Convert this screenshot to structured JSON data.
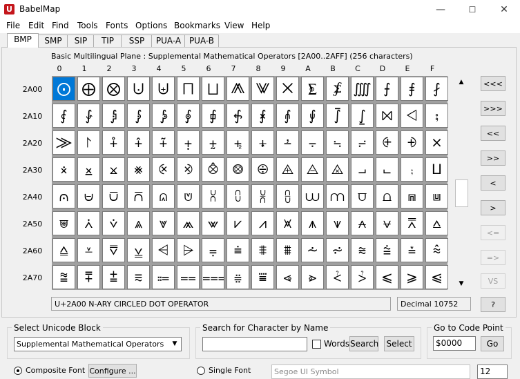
{
  "window": {
    "title": "BabelMap",
    "app_icon": "U",
    "minimize": "—",
    "maximize": "☐",
    "close": "✕"
  },
  "menu": [
    "File",
    "Edit",
    "Find",
    "Tools",
    "Fonts",
    "Options",
    "Bookmarks",
    "View",
    "Help"
  ],
  "tabs": [
    "BMP",
    "SMP",
    "SIP",
    "TIP",
    "SSP",
    "PUA-A",
    "PUA-B"
  ],
  "active_tab": "BMP",
  "block_title": "Basic Multilingual Plane : Supplemental Mathematical Operators [2A00..2AFF] (256 characters)",
  "columns": [
    "0",
    "1",
    "2",
    "3",
    "4",
    "5",
    "6",
    "7",
    "8",
    "9",
    "A",
    "B",
    "C",
    "D",
    "E",
    "F"
  ],
  "rows": [
    {
      "label": "2A00",
      "cells": [
        "⨀",
        "⨁",
        "⨂",
        "⨃",
        "⨄",
        "⨅",
        "⨆",
        "⨇",
        "⨈",
        "⨉",
        "⨊",
        "⨋",
        "⨌",
        "⨍",
        "⨎",
        "⨏"
      ]
    },
    {
      "label": "2A10",
      "cells": [
        "⨐",
        "⨑",
        "⨒",
        "⨓",
        "⨔",
        "⨕",
        "⨖",
        "⨗",
        "⨘",
        "⨙",
        "⨚",
        "⨛",
        "⨜",
        "⨝",
        "⨞",
        "⨟"
      ]
    },
    {
      "label": "2A20",
      "cells": [
        "⨠",
        "⨡",
        "⨢",
        "⨣",
        "⨤",
        "⨥",
        "⨦",
        "⨧",
        "⨨",
        "⨩",
        "⨪",
        "⨫",
        "⨬",
        "⨭",
        "⨮",
        "⨯"
      ]
    },
    {
      "label": "2A30",
      "cells": [
        "⨰",
        "⨱",
        "⨲",
        "⨳",
        "⨴",
        "⨵",
        "⨶",
        "⨷",
        "⨸",
        "⨹",
        "⨺",
        "⨻",
        "⨼",
        "⨽",
        "⨾",
        "⨿"
      ]
    },
    {
      "label": "2A40",
      "cells": [
        "⩀",
        "⩁",
        "⩂",
        "⩃",
        "⩄",
        "⩅",
        "⩆",
        "⩇",
        "⩈",
        "⩉",
        "⩊",
        "⩋",
        "⩌",
        "⩍",
        "⩎",
        "⩏"
      ]
    },
    {
      "label": "2A50",
      "cells": [
        "⩐",
        "⩑",
        "⩒",
        "⩓",
        "⩔",
        "⩕",
        "⩖",
        "⩗",
        "⩘",
        "⩙",
        "⩚",
        "⩛",
        "⩜",
        "⩝",
        "⩞",
        "⩟"
      ]
    },
    {
      "label": "2A60",
      "cells": [
        "⩠",
        "⩡",
        "⩢",
        "⩣",
        "⩤",
        "⩥",
        "⩦",
        "⩧",
        "⩨",
        "⩩",
        "⩪",
        "⩫",
        "⩬",
        "⩭",
        "⩮",
        "⩯"
      ]
    },
    {
      "label": "2A70",
      "cells": [
        "⩰",
        "⩱",
        "⩲",
        "⩳",
        "⩴",
        "⩵",
        "⩶",
        "⩷",
        "⩸",
        "⩹",
        "⩺",
        "⩻",
        "⩼",
        "⩽",
        "⩾",
        "⩿"
      ]
    }
  ],
  "nav_buttons": [
    "<<<",
    ">>>",
    "<<",
    ">>",
    "<",
    ">",
    "<=",
    "=>",
    "VS",
    "?"
  ],
  "status": {
    "char_name": "U+2A00 N-ARY CIRCLED DOT OPERATOR",
    "decimal": "Decimal 10752"
  },
  "select_block": {
    "label": "Select Unicode Block",
    "value": "Supplemental Mathematical Operators"
  },
  "search": {
    "label": "Search for Character by Name",
    "value": "",
    "words_label": "Words",
    "search_btn": "Search",
    "select_btn": "Select"
  },
  "goto": {
    "label": "Go to Code Point",
    "value": "$0000",
    "go_btn": "Go"
  },
  "font": {
    "composite_label": "Composite Font",
    "configure_btn": "Configure ...",
    "single_label": "Single Font",
    "single_value": "Segoe UI Symbol",
    "size": "12"
  }
}
